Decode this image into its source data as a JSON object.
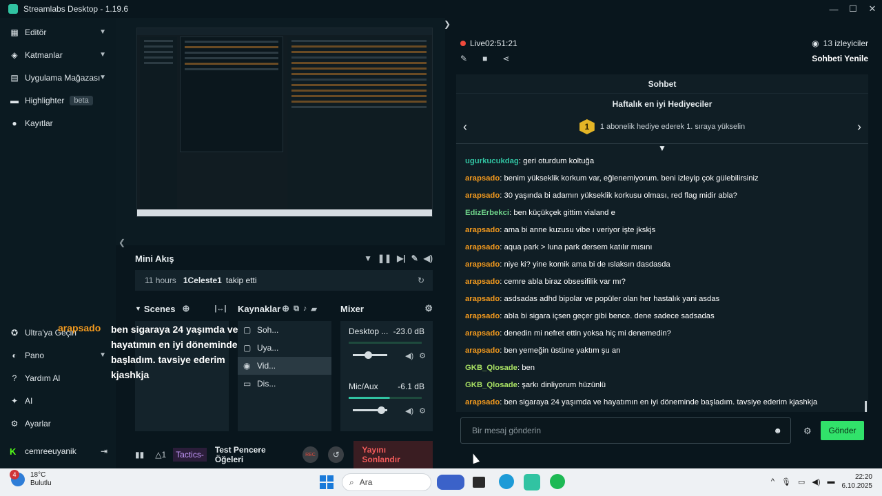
{
  "window": {
    "title": "Streamlabs Desktop - 1.19.6",
    "controls": [
      "—",
      "☐",
      "✕"
    ]
  },
  "sidebar": {
    "items": [
      {
        "label": "Editör",
        "icon": "editor-icon"
      },
      {
        "label": "Katmanlar",
        "icon": "layers-icon"
      },
      {
        "label": "Uygulama Mağazası",
        "icon": "store-icon"
      },
      {
        "label": "Highlighter",
        "icon": "highlighter-icon",
        "badge": "beta"
      },
      {
        "label": "Kayıtlar",
        "icon": "recordings-icon"
      }
    ],
    "bottom_items": [
      {
        "label": "Ultra'ya Geçin"
      },
      {
        "label": "Pano"
      },
      {
        "label": "Yardım Al"
      },
      {
        "label": "AI"
      },
      {
        "label": "Ayarlar"
      }
    ],
    "user": "cemreeuyanik"
  },
  "mini_feed": {
    "title": "Mini Akış",
    "item": {
      "time": "11 hours",
      "user": "1Celeste1",
      "action": "takip etti"
    }
  },
  "docks": {
    "scenes": "Scenes",
    "sources": "Kaynaklar",
    "mixer": "Mixer"
  },
  "sources": [
    {
      "label": "Soh...",
      "selected": false
    },
    {
      "label": "Uya...",
      "selected": false
    },
    {
      "label": "Vid...",
      "selected": true
    },
    {
      "label": "Dis...",
      "selected": false
    }
  ],
  "mixer": [
    {
      "name": "Desktop ...",
      "db": "-23.0 dB",
      "level": 0.45
    },
    {
      "name": "Mic/Aux",
      "db": "-6.1 dB",
      "level": 0.8
    }
  ],
  "bottom_bar": {
    "alerts": "1",
    "tactics": "Tactics-",
    "test": "Test Pencere Öğeleri",
    "rec": "REC",
    "end_stream": "Yayını Sonlandır"
  },
  "overlay": {
    "name": "arapsado",
    "message": "ben sigaraya 24 yaşımda ve hayatımın en iyi döneminde başladım. tavsiye ederim kjashkja"
  },
  "stream": {
    "status": "Live",
    "duration": "02:51:21",
    "viewers": "13 izleyiciler",
    "refresh_chat": "Sohbeti Yenile"
  },
  "chat": {
    "title": "Sohbet",
    "top_gifters_title": "Haftalık en iyi Hediyeciler",
    "rank": "1",
    "gifter_text": "1 abonelik hediye ederek 1. sıraya yükselin",
    "messages": [
      {
        "user": "ugurkucukdag",
        "color": "#31c3a2",
        "text": ": geri oturdum koltuğa"
      },
      {
        "user": "arapsado",
        "color": "#f39a1e",
        "text": ": benim yükseklik korkum var, eğlenemiyorum. beni izleyip çok gülebilirsiniz"
      },
      {
        "user": "arapsado",
        "color": "#f39a1e",
        "text": ": 30 yaşında bi adamın yükseklik korkusu olması, red flag midir abla?"
      },
      {
        "user": "EdizErbekci",
        "color": "#6fd38a",
        "text": ": ben küçükçek gittim vialand e"
      },
      {
        "user": "arapsado",
        "color": "#f39a1e",
        "text": ": ama bi anne kuzusu vibe ı veriyor işte jkskjs"
      },
      {
        "user": "arapsado",
        "color": "#f39a1e",
        "text": ": aqua park > luna park dersem katılır mısını"
      },
      {
        "user": "arapsado",
        "color": "#f39a1e",
        "text": ": niye ki? yine komik ama bi de ıslaksın dasdasda"
      },
      {
        "user": "arapsado",
        "color": "#f39a1e",
        "text": ": cemre abla biraz obsesifilik var mı?"
      },
      {
        "user": "arapsado",
        "color": "#f39a1e",
        "text": ": asdsadas adhd bipolar ve popüler olan her hastalık yani asdas"
      },
      {
        "user": "arapsado",
        "color": "#f39a1e",
        "text": ": abla bi sigara içsen geçer gibi bence. dene sadece sadsadas"
      },
      {
        "user": "arapsado",
        "color": "#f39a1e",
        "text": ": denedin mi nefret ettin yoksa hiç mi denemedin?"
      },
      {
        "user": "arapsado",
        "color": "#f39a1e",
        "text": ": ben yemeğin üstüne yaktım şu an"
      },
      {
        "user": "GKB_Qlosade",
        "color": "#a8e063",
        "text": ": ben"
      },
      {
        "user": "GKB_Qlosade",
        "color": "#a8e063",
        "text": ": şarkı dinliyorum hüzünlü"
      },
      {
        "user": "arapsado",
        "color": "#f39a1e",
        "text": ": ben sigaraya 24 yaşımda ve hayatımın en iyi döneminde başladım. tavsiye ederim kjashkja"
      }
    ],
    "input_placeholder": "Bir mesaj gönderin",
    "send_label": "Gönder"
  },
  "taskbar": {
    "weather_temp": "18°C",
    "weather_desc": "Bulutlu",
    "notification_count": "4",
    "search_placeholder": "Ara",
    "time": "22:20",
    "date": "6.10.2025"
  }
}
